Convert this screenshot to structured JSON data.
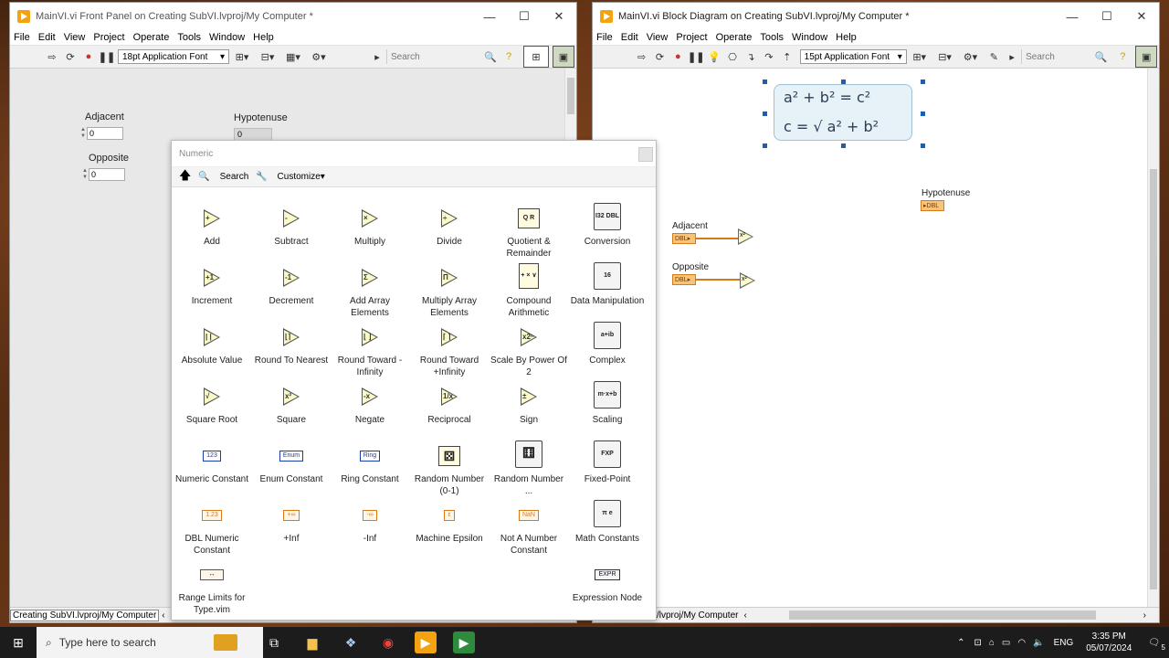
{
  "front_panel": {
    "title": "MainVI.vi Front Panel on Creating SubVI.lvproj/My Computer *",
    "menu": [
      "File",
      "Edit",
      "View",
      "Project",
      "Operate",
      "Tools",
      "Window",
      "Help"
    ],
    "font": "18pt Application Font",
    "search_placeholder": "Search",
    "controls": {
      "adjacent_label": "Adjacent",
      "adjacent_value": "0",
      "opposite_label": "Opposite",
      "opposite_value": "0",
      "hypotenuse_label": "Hypotenuse",
      "hypotenuse_value": "0"
    },
    "status_path": "Creating SubVI.lvproj/My Computer"
  },
  "block_diagram": {
    "title": "MainVI.vi Block Diagram on Creating SubVI.lvproj/My Computer *",
    "menu": [
      "File",
      "Edit",
      "View",
      "Project",
      "Operate",
      "Tools",
      "Window",
      "Help"
    ],
    "font": "15pt Application Font",
    "search_placeholder": "Search",
    "formula_line1": "a² + b² = c²",
    "formula_line2": "c = √ a² + b²",
    "terminals": {
      "adjacent_label": "Adjacent",
      "opposite_label": "Opposite",
      "hypotenuse_label": "Hypotenuse",
      "dbl": "DBL"
    },
    "status_path": "/lvproj/My Computer"
  },
  "palette": {
    "title": "Numeric",
    "search_label": "Search",
    "customize_label": "Customize▾",
    "items": [
      {
        "label": "Add",
        "icon": "add-icon"
      },
      {
        "label": "Subtract",
        "icon": "subtract-icon"
      },
      {
        "label": "Multiply",
        "icon": "multiply-icon"
      },
      {
        "label": "Divide",
        "icon": "divide-icon"
      },
      {
        "label": "Quotient & Remainder",
        "icon": "quotient-remainder-icon"
      },
      {
        "label": "Conversion",
        "icon": "conversion-icon"
      },
      {
        "label": "Increment",
        "icon": "increment-icon"
      },
      {
        "label": "Decrement",
        "icon": "decrement-icon"
      },
      {
        "label": "Add Array Elements",
        "icon": "add-array-elements-icon"
      },
      {
        "label": "Multiply Array Elements",
        "icon": "multiply-array-elements-icon"
      },
      {
        "label": "Compound Arithmetic",
        "icon": "compound-arithmetic-icon"
      },
      {
        "label": "Data Manipulation",
        "icon": "data-manipulation-icon"
      },
      {
        "label": "Absolute Value",
        "icon": "absolute-value-icon"
      },
      {
        "label": "Round To Nearest",
        "icon": "round-to-nearest-icon"
      },
      {
        "label": "Round Toward -Infinity",
        "icon": "round-toward-neg-infinity-icon"
      },
      {
        "label": "Round Toward +Infinity",
        "icon": "round-toward-pos-infinity-icon"
      },
      {
        "label": "Scale By Power Of 2",
        "icon": "scale-by-power-of-2-icon"
      },
      {
        "label": "Complex",
        "icon": "complex-icon"
      },
      {
        "label": "Square Root",
        "icon": "square-root-icon"
      },
      {
        "label": "Square",
        "icon": "square-icon"
      },
      {
        "label": "Negate",
        "icon": "negate-icon"
      },
      {
        "label": "Reciprocal",
        "icon": "reciprocal-icon"
      },
      {
        "label": "Sign",
        "icon": "sign-icon"
      },
      {
        "label": "Scaling",
        "icon": "scaling-icon"
      },
      {
        "label": "Numeric Constant",
        "icon": "numeric-constant-icon"
      },
      {
        "label": "Enum Constant",
        "icon": "enum-constant-icon"
      },
      {
        "label": "Ring Constant",
        "icon": "ring-constant-icon"
      },
      {
        "label": "Random Number (0-1)",
        "icon": "random-number-icon"
      },
      {
        "label": "Random Number ...",
        "icon": "random-number-range-icon"
      },
      {
        "label": "Fixed-Point",
        "icon": "fixed-point-icon"
      },
      {
        "label": "DBL Numeric Constant",
        "icon": "dbl-numeric-constant-icon"
      },
      {
        "label": "+Inf",
        "icon": "pos-inf-icon"
      },
      {
        "label": "-Inf",
        "icon": "neg-inf-icon"
      },
      {
        "label": "Machine Epsilon",
        "icon": "machine-epsilon-icon"
      },
      {
        "label": "Not A Number Constant",
        "icon": "nan-constant-icon"
      },
      {
        "label": "Math Constants",
        "icon": "math-constants-icon"
      },
      {
        "label": "Range Limits for Type.vim",
        "icon": "range-limits-icon"
      },
      {
        "label": "Expression Node",
        "icon": "expression-node-icon"
      }
    ],
    "glyphs": {
      "add": "+",
      "subtract": "-",
      "multiply": "×",
      "divide": "÷",
      "quotient": "Q R",
      "conversion": "I32 DBL",
      "increment": "+1",
      "decrement": "-1",
      "sum": "Σ",
      "product": "Π",
      "compound": "+ × ∨",
      "datamanip": "16",
      "abs": "| |",
      "round": "⌊⌉",
      "roundneg": "⌊ ⌋",
      "roundpos": "⌈ ⌉",
      "scale": "x2ⁿ",
      "complex": "a+ib",
      "sqrt": "√",
      "square": "x²",
      "negate": "-x",
      "reciprocal": "1/x",
      "sign": "±",
      "scaling": "m·x+b",
      "num": "123",
      "enum": "Enum",
      "ring": "Ring",
      "rand": "⚄",
      "randr": "⚅",
      "fxp": "FXP",
      "dblconst": "1.23",
      "pinf": "+∞",
      "ninf": "-∞",
      "eps": "ε",
      "nan": "NaN",
      "math": "π e",
      "range": "↔",
      "expr": "EXPR"
    }
  },
  "taskbar": {
    "search_placeholder": "Type here to search",
    "language": "ENG",
    "time": "3:35 PM",
    "date": "05/07/2024",
    "notifications": "5"
  },
  "colors": {
    "labview_orange": "#f2a30f",
    "dbl_orange": "#d97a18",
    "selection_blue": "#1a5fb4"
  }
}
